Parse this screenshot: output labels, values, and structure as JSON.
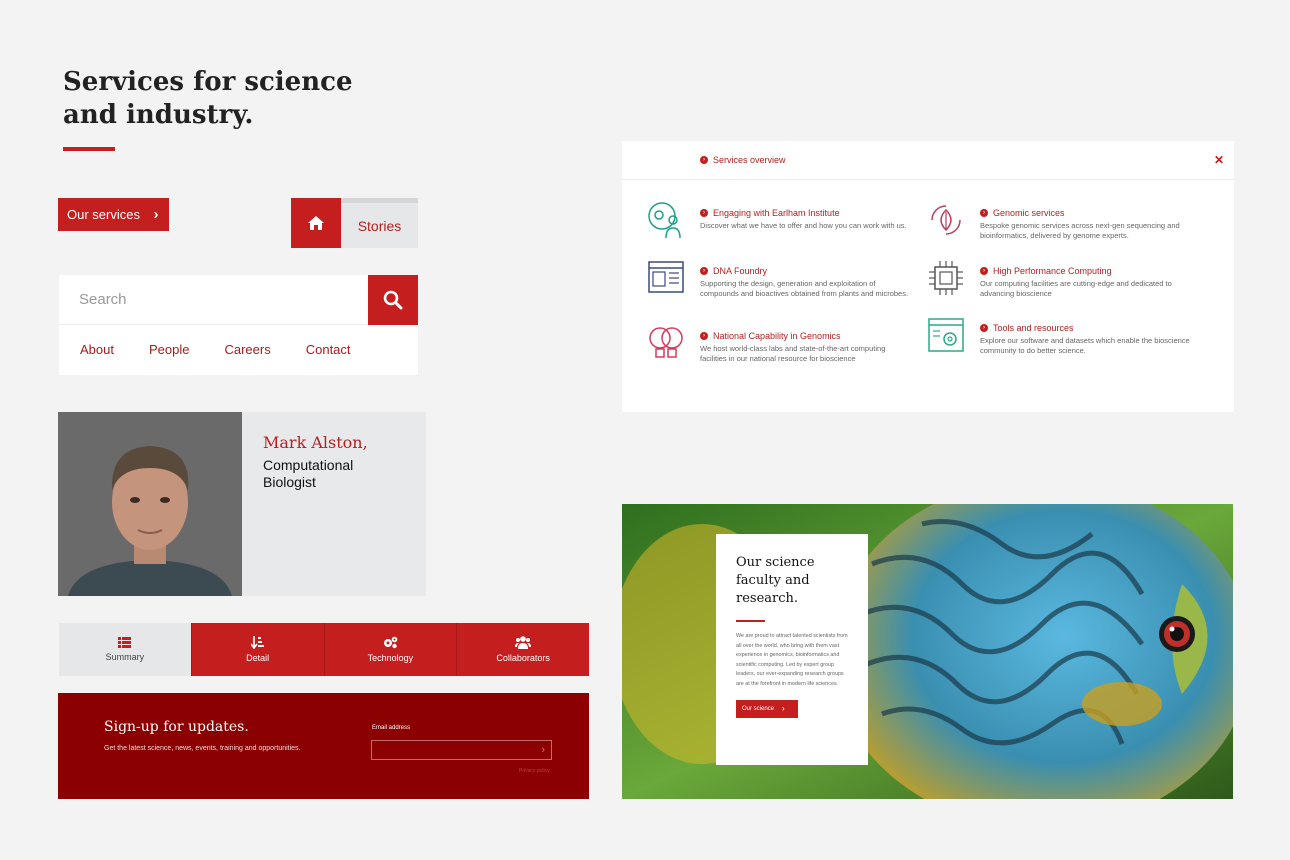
{
  "hero": {
    "title": "Services for science and industry."
  },
  "services_button": {
    "label": "Our services"
  },
  "home_stories": {
    "stories_label": "Stories"
  },
  "search": {
    "placeholder": "Search",
    "nav": [
      "About",
      "People",
      "Careers",
      "Contact"
    ]
  },
  "profile": {
    "name": "Mark Alston,",
    "role": "Computational Biologist"
  },
  "tabs": [
    {
      "label": "Summary",
      "icon": "list-icon",
      "active": true
    },
    {
      "label": "Detail",
      "icon": "sort-icon",
      "active": false
    },
    {
      "label": "Technology",
      "icon": "cogs-icon",
      "active": false
    },
    {
      "label": "Collaborators",
      "icon": "users-icon",
      "active": false
    }
  ],
  "signup": {
    "title": "Sign-up for updates.",
    "subtitle": "Get the latest science, news, events, training and opportunities.",
    "email_label": "Email address",
    "privacy": "Privacy policy"
  },
  "overview": {
    "title": "Services overview",
    "services": [
      {
        "title": "Engaging with Earlham Institute",
        "desc": "Discover what we have to offer and how you can work with us.",
        "icon": "person-gear-icon"
      },
      {
        "title": "Genomic services",
        "desc": "Bespoke genomic services across next-gen sequencing and bioinformatics, delivered by genome experts.",
        "icon": "leaf-cycle-icon"
      },
      {
        "title": "DNA Foundry",
        "desc": "Supporting the design, generation and exploitation of compounds and bioactives obtained from plants and microbes.",
        "icon": "dna-panel-icon"
      },
      {
        "title": "High Performance Computing",
        "desc": "Our computing facilities are cutting-edge and dedicated to advancing bioscience",
        "icon": "chip-icon"
      },
      {
        "title": "National Capability in Genomics",
        "desc": "We host world-class labs and state-of-the-art computing facilities in our national resource for bioscience",
        "icon": "lightbulb-dna-icon"
      },
      {
        "title": "Tools and resources",
        "desc": "Explore our software and datasets which enable the bioscience community to do better science.",
        "icon": "browser-gear-icon"
      }
    ]
  },
  "science": {
    "title": "Our science faculty and research.",
    "text": "We are proud to attract talented scientists from all over the world, who bring with them vast experience in genomics, bioinformatics and scientific computing. Led by expert group leaders, our ever-expanding research groups are at the forefront in modern life sciences.",
    "button": "Our science"
  },
  "colors": {
    "accent": "#c41e1e",
    "dark_red": "#8b0000",
    "teal": "#1aa08a",
    "navy": "#3a4a7a"
  }
}
